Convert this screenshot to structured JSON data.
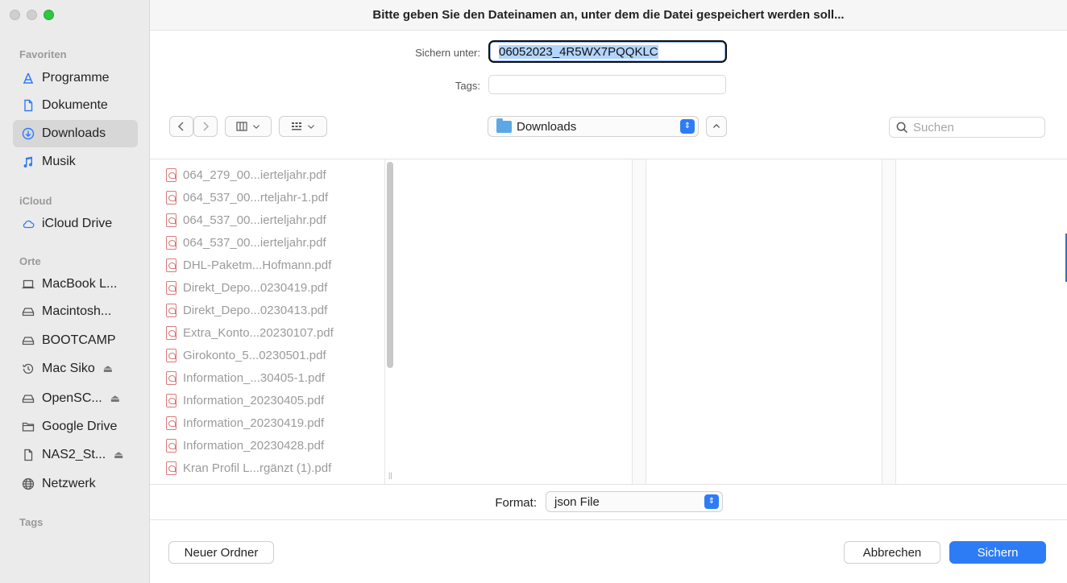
{
  "dialog": {
    "title": "Bitte geben Sie den Dateinamen an, unter dem die Datei gespeichert werden soll..."
  },
  "form": {
    "save_as_label": "Sichern unter:",
    "save_as_value": "06052023_4R5WX7PQQKLC",
    "tags_label": "Tags:",
    "tags_value": ""
  },
  "toolbar": {
    "location": "Downloads",
    "search_placeholder": "Suchen"
  },
  "sidebar": {
    "favorites_header": "Favoriten",
    "favorites": [
      {
        "label": "Programme",
        "icon": "apps-icon"
      },
      {
        "label": "Dokumente",
        "icon": "document-icon"
      },
      {
        "label": "Downloads",
        "icon": "download-icon",
        "selected": true
      },
      {
        "label": "Musik",
        "icon": "music-icon"
      }
    ],
    "icloud_header": "iCloud",
    "icloud": [
      {
        "label": "iCloud Drive",
        "icon": "cloud-icon"
      }
    ],
    "places_header": "Orte",
    "places": [
      {
        "label": "MacBook L...",
        "icon": "laptop-icon"
      },
      {
        "label": "Macintosh...",
        "icon": "drive-icon"
      },
      {
        "label": "BOOTCAMP",
        "icon": "drive-icon"
      },
      {
        "label": "Mac Siko",
        "icon": "time-machine-icon",
        "eject": true
      },
      {
        "label": "OpenSC...",
        "icon": "drive-icon",
        "eject": true
      },
      {
        "label": "Google Drive",
        "icon": "folder-icon"
      },
      {
        "label": "NAS2_St...",
        "icon": "document-icon",
        "eject": true
      },
      {
        "label": "Netzwerk",
        "icon": "network-icon"
      }
    ],
    "tags_header": "Tags"
  },
  "files": [
    "064_279_00...ierteljahr.pdf",
    "064_537_00...rteljahr-1.pdf",
    "064_537_00...ierteljahr.pdf",
    "064_537_00...ierteljahr.pdf",
    "DHL-Paketm...Hofmann.pdf",
    "Direkt_Depo...0230419.pdf",
    "Direkt_Depo...0230413.pdf",
    "Extra_Konto...20230107.pdf",
    "Girokonto_5...0230501.pdf",
    "Information_...30405-1.pdf",
    "Information_20230405.pdf",
    "Information_20230419.pdf",
    "Information_20230428.pdf",
    "Kran Profil L...rgänzt (1).pdf"
  ],
  "format": {
    "label": "Format:",
    "value": "json File"
  },
  "buttons": {
    "new_folder": "Neuer Ordner",
    "cancel": "Abbrechen",
    "save": "Sichern"
  },
  "colors": {
    "accent": "#2d7cf6",
    "sidebar_bg": "#ebebeb",
    "selection": "#d7d7d7"
  }
}
